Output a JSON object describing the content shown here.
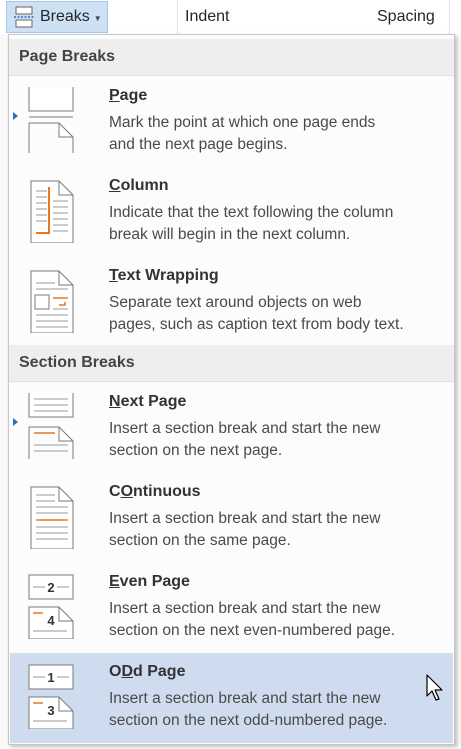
{
  "toolbar": {
    "breaks_label": "Breaks",
    "indent_label": "Indent",
    "spacing_label": "Spacing"
  },
  "menu": {
    "page_breaks_header": "Page Breaks",
    "section_breaks_header": "Section Breaks",
    "items": [
      {
        "title": "Page",
        "accel": "P",
        "rest": "age",
        "desc1": "Mark the point at which one page ends",
        "desc2": "and the next page begins.",
        "icon": "page-break-icon"
      },
      {
        "title": "Column",
        "accel": "C",
        "rest": "olumn",
        "desc1": "Indicate that the text following the column",
        "desc2": "break will begin in the next column.",
        "icon": "column-break-icon"
      },
      {
        "title": "Text Wrapping",
        "accel": "T",
        "rest": "ext Wrapping",
        "desc1": "Separate text around objects on web",
        "desc2": "pages, such as caption text from body text.",
        "icon": "text-wrapping-icon"
      },
      {
        "title": "Next Page",
        "accel": "N",
        "rest": "ext Page",
        "desc1": "Insert a section break and start the new",
        "desc2": "section on the next page.",
        "icon": "next-page-icon"
      },
      {
        "title": "Continuous",
        "accel": "O",
        "rest": "ntinuous",
        "pre": "C",
        "desc1": "Insert a section break and start the new",
        "desc2": "section on the same page.",
        "icon": "continuous-icon"
      },
      {
        "title": "Even Page",
        "accel": "E",
        "rest": "ven Page",
        "desc1": "Insert a section break and start the new",
        "desc2": "section on the next even-numbered page.",
        "icon": "even-page-icon",
        "num_top": "2",
        "num_bottom": "4"
      },
      {
        "title": "Odd Page",
        "accel": "D",
        "rest": "d Page",
        "pre": "O",
        "desc1": "Insert a section break and start the new",
        "desc2": "section on the next odd-numbered page.",
        "icon": "odd-page-icon",
        "num_top": "1",
        "num_bottom": "3"
      }
    ]
  },
  "colors": {
    "accent": "#e87722",
    "selection": "#cfdcef",
    "header_bg": "#eeeeee"
  }
}
